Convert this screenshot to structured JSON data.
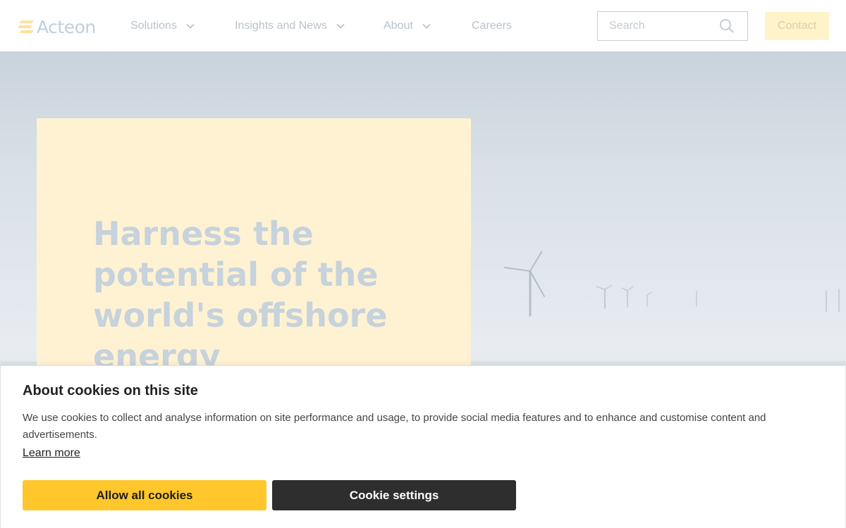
{
  "header": {
    "logo_text": "Acteon",
    "nav": [
      {
        "label": "Solutions",
        "has_dropdown": true,
        "icon": "chevron-down-icon"
      },
      {
        "label": "Insights and News",
        "has_dropdown": true,
        "icon": "chevron-down-icon"
      },
      {
        "label": "About",
        "has_dropdown": true,
        "icon": "chevron-down-icon"
      },
      {
        "label": "Careers",
        "has_dropdown": false
      }
    ],
    "search": {
      "placeholder": "Search",
      "value": "",
      "icon": "search-icon"
    },
    "contact_label": "Contact"
  },
  "hero": {
    "title": "Harness the potential of the world's offshore energy resources"
  },
  "cookie_banner": {
    "title": "About cookies on this site",
    "text": "We use cookies to collect and analyse information on site performance and usage, to provide social media features and to enhance and customise content and advertisements.",
    "learn_more": "Learn more",
    "allow_label": "Allow all cookies",
    "settings_label": "Cookie settings"
  },
  "colors": {
    "accent_yellow": "#ffc72c",
    "dark_button": "#2e2e2e",
    "hero_card": "#fff2d2",
    "contact_button": "#fff3c9"
  }
}
